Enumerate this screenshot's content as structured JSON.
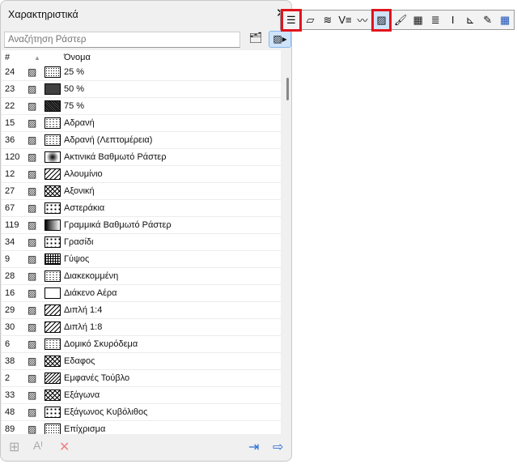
{
  "panel": {
    "title": "Χαρακτηριστικά",
    "search_placeholder": "Αναζήτηση Ράστερ",
    "columns": {
      "num": "#",
      "name": "Όνομα"
    },
    "rows": [
      {
        "num": "24",
        "name": "25 %",
        "pattern": "dots-light"
      },
      {
        "num": "23",
        "name": "50 %",
        "pattern": "dots-mid"
      },
      {
        "num": "22",
        "name": "75 %",
        "pattern": "dots-dark"
      },
      {
        "num": "15",
        "name": "Αδρανή",
        "pattern": "speckle"
      },
      {
        "num": "36",
        "name": "Αδρανή (Λεπτομέρεια)",
        "pattern": "speckle"
      },
      {
        "num": "120",
        "name": "Ακτινικά Βαθμωτό Ράστερ",
        "pattern": "radial"
      },
      {
        "num": "12",
        "name": "Αλουμίνιο",
        "pattern": "diag"
      },
      {
        "num": "27",
        "name": "Αξονική",
        "pattern": "cross"
      },
      {
        "num": "67",
        "name": "Αστεράκια",
        "pattern": "stars"
      },
      {
        "num": "119",
        "name": "Γραμμικά Βαθμωτό Ράστερ",
        "pattern": "linear"
      },
      {
        "num": "34",
        "name": "Γρασίδι",
        "pattern": "stars"
      },
      {
        "num": "9",
        "name": "Γύψος",
        "pattern": "grid"
      },
      {
        "num": "28",
        "name": "Διακεκομμένη",
        "pattern": "speckle"
      },
      {
        "num": "16",
        "name": "Διάκενο Αέρα",
        "pattern": "empty"
      },
      {
        "num": "29",
        "name": "Διπλή 1:4",
        "pattern": "diag"
      },
      {
        "num": "30",
        "name": "Διπλή 1:8",
        "pattern": "diag"
      },
      {
        "num": "6",
        "name": "Δομικό Σκυρόδεμα",
        "pattern": "speckle"
      },
      {
        "num": "38",
        "name": "Εδαφος",
        "pattern": "cross"
      },
      {
        "num": "2",
        "name": "Εμφανές Τούβλο",
        "pattern": "diag-dense"
      },
      {
        "num": "33",
        "name": "Εξάγωνα",
        "pattern": "cross"
      },
      {
        "num": "48",
        "name": "Εξάγωνος Κυβόλιθος",
        "pattern": "stars"
      },
      {
        "num": "89",
        "name": "Επίχρισμα",
        "pattern": "dots-light"
      }
    ]
  },
  "toolbar": {
    "items": [
      "list-icon",
      "slab-icon",
      "roof-icon",
      "label-icon",
      "line-icon",
      "fill-icon",
      "brush-icon",
      "brick-icon",
      "layers-icon",
      "column-icon",
      "profile-icon",
      "pen-icon",
      "grid-icon"
    ],
    "selected": "list-icon",
    "current": "fill-icon"
  },
  "colors": {
    "accent": "#e0141e",
    "selected_bg": "#cfe3fa"
  }
}
